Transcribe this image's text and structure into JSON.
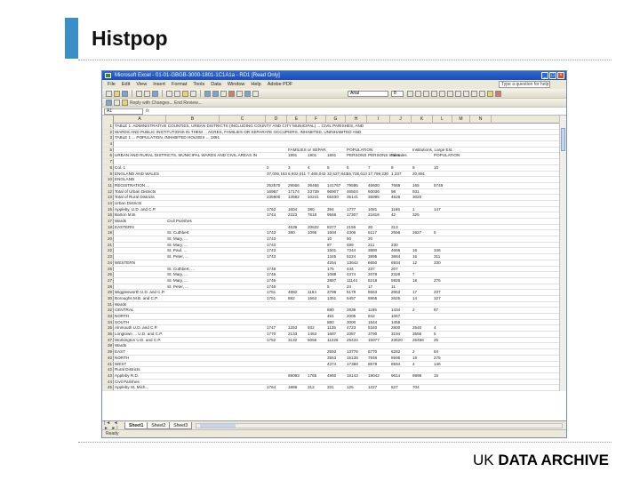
{
  "slide": {
    "title": "Histpop",
    "brand_left": "UK ",
    "brand_bold": "DATA ARCHIVE"
  },
  "window": {
    "title": "Microsoft Excel - 01-01-GBGB-3000-1801-1C1A1a - RD1 [Read Only]"
  },
  "menu": {
    "items": [
      "File",
      "Edit",
      "View",
      "Insert",
      "Format",
      "Tools",
      "Data",
      "Window",
      "Help",
      "Adobe PDF"
    ],
    "help_placeholder": "Type a question for help"
  },
  "toolbar": {
    "font": "Arial",
    "size": "8"
  },
  "toolbar2_text": "Reply with Changes...  End Review...",
  "formula": {
    "name_box": "A1",
    "fx": "fx",
    "content": ""
  },
  "columns": [
    "A",
    "B",
    "C",
    "D",
    "E",
    "F",
    "G",
    "H",
    "I",
    "J",
    "K",
    "L",
    "M",
    "N"
  ],
  "rows": [
    {
      "n": "1",
      "A": "TABLE 1. ADMINISTRATIVE COUNTIES, URBAN DISTRICTS (INCLUDING COUNTY AND CITY MUNICIPAL) ... CIVIL PARISHES, AND"
    },
    {
      "n": "2",
      "A": "WARDS AND PUBLIC INSTITUTIONS IN THEM ... ACRES, FAMILIES OR SEPARATE OCCUPIERS, INHABITED, UNINHABITED AND"
    },
    {
      "n": "3",
      "A": "TABLE 1 ... POPULATION, INHABITED HOUSES ... 1891"
    },
    {
      "n": "4"
    },
    {
      "n": "5",
      "E": "FAMILIES or SEPAR.",
      "H": "POPULATION",
      "K": "Institutions, Large Est."
    },
    {
      "n": "6",
      "A": "URBAN AND RURAL DISTRICTS, MUNICIPAL WARDS AND CIVIL AREAS IN",
      "E": "1891",
      "F": "1901",
      "G": "1891",
      "H": "PERSONS",
      "I": "PERSONS males",
      "J": "Females",
      "L": "POPULATION"
    },
    {
      "n": "7"
    },
    {
      "n": "8",
      "A": "Col. 1",
      "D": "2",
      "E": "3",
      "F": "4",
      "G": "5",
      "H": "6",
      "I": "7",
      "J": "8",
      "K": "9",
      "L": "10"
    },
    {
      "n": "9",
      "A": "ENGLAND AND WALES",
      "D": "37,000,153",
      "E": "6,932,011",
      "F": "7,469,043",
      "G": "32,527,843",
      "H": "15,728,613",
      "I": "17,799,230",
      "J": "1,237",
      "K": "20,891"
    },
    {
      "n": "10",
      "A": "ENGLAND"
    },
    {
      "n": "11",
      "A": "REGISTRATION ...",
      "D": "252570",
      "E": "29566",
      "F": "36486",
      "G": "141767",
      "H": "79595",
      "I": "46600",
      "J": "7668",
      "K": "165",
      "L": "5748"
    },
    {
      "n": "12",
      "A": "Total of Urban Districts",
      "D": "16987",
      "E": "17174",
      "F": "23739",
      "G": "96907",
      "H": "46504",
      "I": "60036",
      "J": "98",
      "K": "931"
    },
    {
      "n": "13",
      "A": "Total of Rural Districts",
      "D": "235900",
      "E": "13582",
      "F": "10241",
      "G": "56400",
      "H": "35141",
      "I": "35995",
      "J": "4826",
      "K": "3020"
    },
    {
      "n": "14",
      "A": "Urban Districts"
    },
    {
      "n": "15",
      "A": "Appleby, U.D. and C.P.",
      "D": "1762",
      "E": "1604",
      "F": "380",
      "G": "394",
      "H": "1777",
      "I": "1081",
      "J": "1165",
      "K": "1",
      "L": "147"
    },
    {
      "n": "16",
      "A": "Barton M.B.",
      "D": "1744",
      "E": "2223",
      "F": "7618",
      "G": "9566",
      "H": "17307",
      "I": "21816",
      "J": "42",
      "K": "325"
    },
    {
      "n": "17",
      "A": "Wards",
      "B": "Civil Parishes"
    },
    {
      "n": "18",
      "A": "EASTERN",
      "E": "4539",
      "F": "20632",
      "G": "8377",
      "H": "2156",
      "I": "30",
      "J": "313"
    },
    {
      "n": "19",
      "B": "St. Cuthbert",
      "D": "1743",
      "E": "380",
      "F": "1095",
      "G": "1504",
      "H": "4306",
      "I": "5117",
      "J": "2556",
      "K": "2627",
      "L": "5"
    },
    {
      "n": "20",
      "B": "St. Mary, ...",
      "D": "1743",
      "G": "10",
      "H": "50",
      "I": "20"
    },
    {
      "n": "21",
      "B": "St. Mary, ...",
      "D": "1743",
      "G": "87",
      "H": "499",
      "I": "211",
      "J": "230"
    },
    {
      "n": "22",
      "B": "St. Paul, ...",
      "D": "1743",
      "G": "1501",
      "H": "7344",
      "I": "3880",
      "J": "4666",
      "K": "16",
      "L": "346"
    },
    {
      "n": "23",
      "B": "St. Peter, ...",
      "D": "1743",
      "G": "1345",
      "H": "5224",
      "I": "3895",
      "J": "3684",
      "K": "16",
      "L": "311"
    },
    {
      "n": "24",
      "A": "WESTERN",
      "G": "4254",
      "H": "13642",
      "I": "6650",
      "J": "6934",
      "K": "12",
      "L": "330"
    },
    {
      "n": "25",
      "B": "St. Cuthbert, ...",
      "D": "1746",
      "G": "175",
      "H": "444",
      "I": "237",
      "J": "207"
    },
    {
      "n": "26",
      "B": "St. Mary, ...",
      "D": "1746",
      "G": "1088",
      "H": "4374",
      "I": "2078",
      "J": "2326",
      "K": "7"
    },
    {
      "n": "27",
      "B": "St. Mary, ...",
      "D": "1746",
      "G": "2887",
      "H": "11144",
      "I": "5218",
      "J": "5926",
      "K": "18",
      "L": "276"
    },
    {
      "n": "28",
      "B": "St. Peter, ...",
      "D": "1746",
      "G": "5",
      "H": "24",
      "I": "17",
      "J": "11"
    },
    {
      "n": "29",
      "A": "Wigglesworth U.D. and C.P.",
      "D": "1751",
      "E": "4882",
      "F": "1164",
      "G": "3798",
      "H": "5179",
      "I": "5663",
      "J": "2663",
      "K": "17",
      "L": "237"
    },
    {
      "n": "30",
      "A": "Boroughs M.B. and C.P.",
      "D": "1751",
      "E": "882",
      "F": "1563",
      "G": "1351",
      "H": "5457",
      "I": "5955",
      "J": "2625",
      "K": "14",
      "L": "327"
    },
    {
      "n": "31",
      "A": "Wards"
    },
    {
      "n": "32",
      "A": "CENTRAL",
      "G": "880",
      "H": "2839",
      "I": "1195",
      "J": "1434",
      "K": "2",
      "L": "87"
    },
    {
      "n": "33",
      "A": "NORTH",
      "G": "481",
      "H": "2005",
      "I": "942",
      "J": "1067"
    },
    {
      "n": "34",
      "A": "SOUTH",
      "G": "880",
      "H": "3000",
      "I": "1544",
      "J": "1455"
    },
    {
      "n": "35",
      "A": "Alnmouth U.D. and C.P.",
      "D": "1747",
      "E": "1253",
      "F": "932",
      "G": "1135",
      "H": "4723",
      "I": "5340",
      "J": "2800",
      "K": "2540",
      "L": "4"
    },
    {
      "n": "36",
      "A": "Longtown ... U.D. and C.P.",
      "D": "1770",
      "E": "2133",
      "F": "1463",
      "G": "1687",
      "H": "3387",
      "I": "3790",
      "J": "3194",
      "K": "3556",
      "L": "5"
    },
    {
      "n": "37",
      "A": "Workington U.D. and C.P.",
      "D": "1752",
      "E": "3132",
      "F": "5056",
      "G": "11226",
      "H": "25434",
      "I": "15977",
      "J": "23620",
      "K": "26456",
      "L": "25"
    },
    {
      "n": "38",
      "A": "Wards"
    },
    {
      "n": "39",
      "A": "EAST",
      "G": "2593",
      "H": "13776",
      "I": "6770",
      "J": "6282",
      "K": "2",
      "L": "84"
    },
    {
      "n": "40",
      "A": "NORTH",
      "G": "3553",
      "H": "15138",
      "I": "7546",
      "J": "8595",
      "K": "19",
      "L": "275"
    },
    {
      "n": "41",
      "A": "WEST",
      "G": "4374",
      "H": "17388",
      "I": "8578",
      "J": "8594",
      "K": "4",
      "L": "146"
    },
    {
      "n": "42",
      "A": "Rural Districts"
    },
    {
      "n": "43",
      "A": "Appleby R.D.",
      "E": "69083",
      "F": "1765",
      "G": "4960",
      "H": "18143",
      "I": "19042",
      "J": "9614",
      "K": "9998",
      "L": "15"
    },
    {
      "n": "44",
      "A": "Civil Parishes"
    },
    {
      "n": "45",
      "A": "Appleby St. Mich...",
      "D": "1764",
      "E": "1889",
      "F": "312",
      "G": "331",
      "H": "125",
      "I": "1227",
      "J": "527",
      "K": "704"
    },
    {
      "n": "46",
      "A": "Appleby Walton",
      "D": "1764",
      "E": "600",
      "F": "105",
      "G": "115",
      "H": "482",
      "I": "522",
      "J": "267",
      "K": "304",
      "L": "2"
    },
    {
      "n": "47",
      "A": "Asby ...",
      "D": "1765",
      "E": "1160",
      "F": "14",
      "G": "14",
      "H": "72",
      "I": "72",
      "J": "35",
      "K": "37"
    }
  ],
  "sheets": {
    "nav": "|◄ ◄ ► ►|",
    "tabs": [
      "Sheet1",
      "Sheet2",
      "Sheet3"
    ]
  },
  "status": "Ready"
}
